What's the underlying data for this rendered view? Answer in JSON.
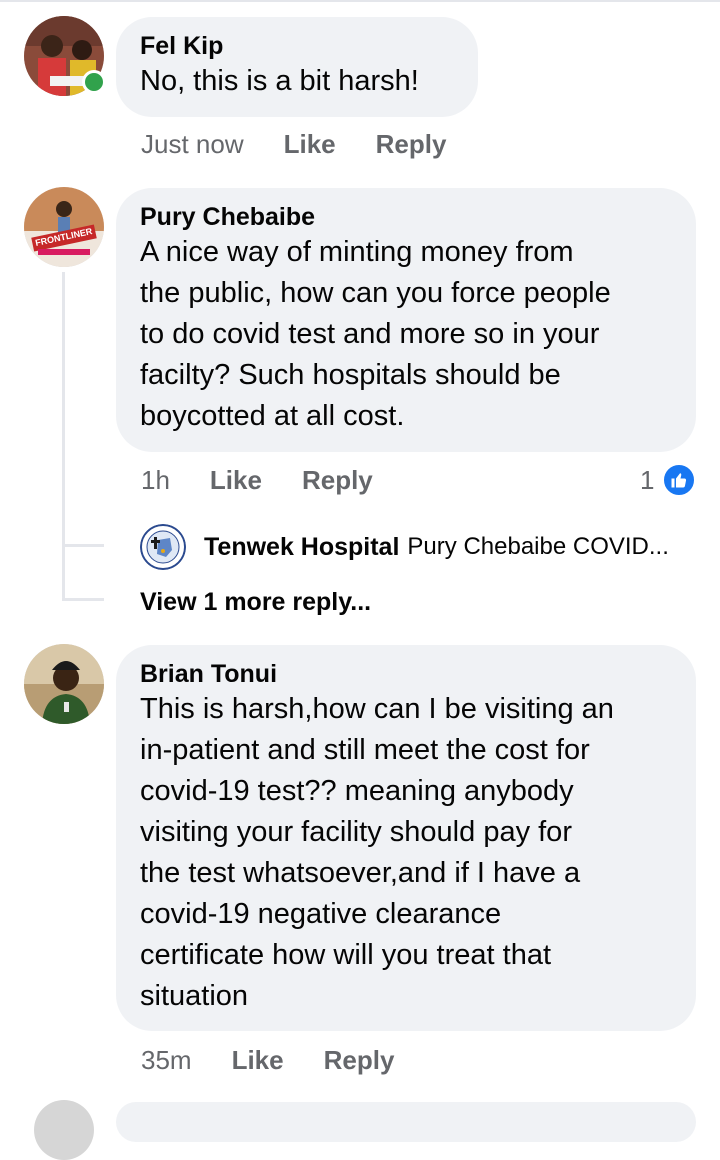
{
  "comments": [
    {
      "author": "Fel Kip",
      "text": "No, this is a bit harsh!",
      "time": "Just now",
      "like_label": "Like",
      "reply_label": "Reply",
      "online": true
    },
    {
      "author": "Pury Chebaibe",
      "text": "A nice way of minting money from\nthe public,  how can you force people\nto do covid test and more so in your\nfacilty?  Such hospitals should be\nboycotted at all cost.",
      "time": "1h",
      "like_label": "Like",
      "reply_label": "Reply",
      "reaction_count": "1",
      "reaction_icon": "thumbs-up-icon",
      "reply_preview": {
        "author": "Tenwek Hospital",
        "snippet": "Pury Chebaibe COVID..."
      },
      "view_more_label": "View 1 more reply..."
    },
    {
      "author": "Brian Tonui",
      "text": "This is harsh,how can I be visiting an\nin-patient and still meet the cost for\ncovid-19 test?? meaning anybody\nvisiting your facility should pay for\nthe test whatsoever,and if I have a\ncovid-19 negative clearance\ncertificate how will you treat that\nsituation",
      "time": "35m",
      "like_label": "Like",
      "reply_label": "Reply"
    }
  ],
  "colors": {
    "bubble": "#f0f2f5",
    "meta_text": "#65676b",
    "like_blue": "#1877f2",
    "online_green": "#31a24c"
  }
}
